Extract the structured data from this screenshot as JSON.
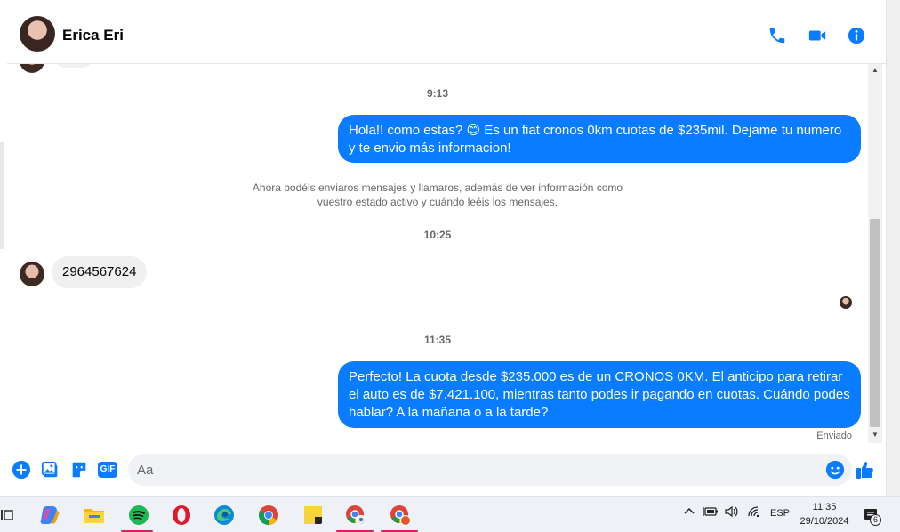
{
  "header": {
    "contact_name": "Erica Eri",
    "icons": [
      "phone-icon",
      "video-camera-icon",
      "info-icon"
    ],
    "accent_color": "#0a7cff"
  },
  "thread": {
    "timestamps": [
      "9:13",
      "10:25",
      "11:35"
    ],
    "outgoing_1": "Hola!! como estas? 😊 Es un fiat cronos 0km cuotas de $235mil. Dejame tu numero y te envio más informacion!",
    "notice_line1": "Ahora podéis enviaros mensajes y llamaros, además de ver información como",
    "notice_line2": "vuestro estado activo y cuándo leéis los mensajes.",
    "incoming_1": "2964567624",
    "outgoing_2": "Perfecto! La cuota desde $235.000 es de un CRONOS 0KM. El anticipo para retirar el auto es de $7.421.100, mientras tanto podes ir pagando en cuotas. Cuándo podes hablar? A la mañana o a la tarde?",
    "status": "Enviado"
  },
  "composer": {
    "placeholder": "Aa",
    "icons": [
      "plus-icon",
      "image-icon",
      "sticker-icon",
      "gif-icon",
      "emoji-icon",
      "thumbs-up-icon"
    ],
    "gif_label": "GIF"
  },
  "taskbar": {
    "apps": [
      "copilot",
      "file-explorer",
      "spotify",
      "opera",
      "edge",
      "chrome",
      "sticky-notes",
      "chrome-profile-1",
      "chrome-profile-2"
    ],
    "language": "ESP",
    "time": "11:35",
    "date": "29/10/2024",
    "notification_count": "6"
  }
}
